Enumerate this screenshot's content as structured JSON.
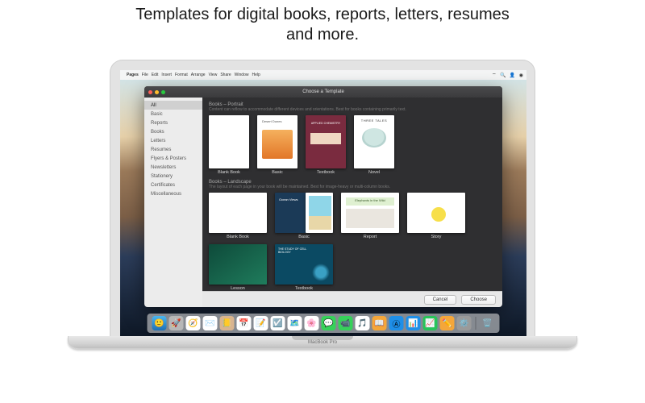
{
  "caption_line1": "Templates for digital books, reports, letters, resumes",
  "caption_line2": "and more.",
  "laptop_model": "MacBook Pro",
  "menubar": {
    "app": "Pages",
    "items": [
      "File",
      "Edit",
      "Insert",
      "Format",
      "Arrange",
      "View",
      "Share",
      "Window",
      "Help"
    ]
  },
  "window": {
    "title": "Choose a Template",
    "sidebar": [
      "All",
      "Basic",
      "Reports",
      "Books",
      "Letters",
      "Resumes",
      "Flyers & Posters",
      "Newsletters",
      "Stationery",
      "Certificates",
      "Miscellaneous"
    ],
    "sections": {
      "portrait": {
        "title": "Books – Portrait",
        "subtitle": "Content can reflow to accommodate different devices and orientations. Best for books containing primarily text.",
        "items": [
          "Blank Book",
          "Basic",
          "Textbook",
          "Novel"
        ],
        "thumb_text": {
          "basic": "Desert Dunes",
          "textbook": "APPLIED CHEMISTRY",
          "novel": "THREE TALES"
        }
      },
      "landscape": {
        "title": "Books – Landscape",
        "subtitle": "The layout of each page in your book will be maintained. Best for image-heavy or multi-column books.",
        "items": [
          "Blank Book",
          "Basic",
          "Report",
          "Story"
        ],
        "thumb_text": {
          "basic": "Ocean Views",
          "report": "Elephants in the Wild"
        }
      },
      "extra": {
        "items": [
          "Lesson",
          "Textbook"
        ],
        "thumb_text": {
          "textbook": "THE STUDY OF CELL BIOLOGY"
        }
      }
    },
    "buttons": {
      "cancel": "Cancel",
      "choose": "Choose"
    }
  },
  "dock_icons": [
    "finder",
    "launchpad",
    "safari",
    "mail",
    "contacts",
    "calendar",
    "notes",
    "reminders",
    "maps",
    "photos",
    "messages",
    "facetime",
    "itunes",
    "ibooks",
    "appstore",
    "keynote",
    "numbers",
    "pages",
    "preferences",
    "trash"
  ]
}
